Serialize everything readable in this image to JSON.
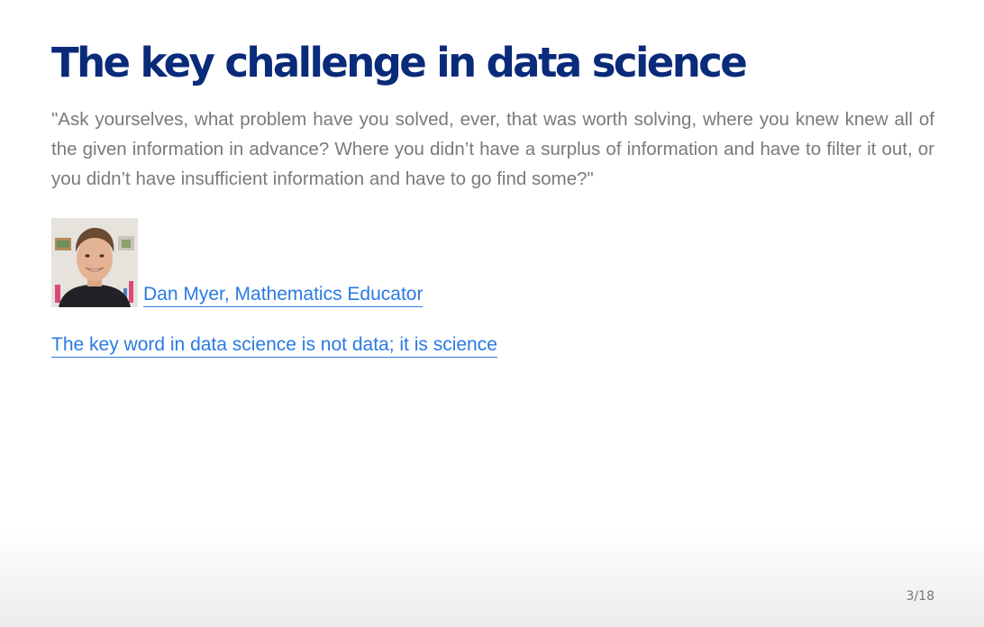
{
  "slide": {
    "title": "The key challenge in data science",
    "quote": "\"Ask yourselves, what problem have you solved, ever, that was worth solving, where you knew knew all of the given information in advance? Where you didn’t have a surplus of information and have to filter it out, or you didn’t have insufficient information and have to go find some?\"",
    "author": {
      "name": "Dan Myer, Mathematics Educator",
      "photo_icon": "person-photo-icon"
    },
    "key_link": "The key word in data science is not data; it is science",
    "page_number": "3/18"
  },
  "colors": {
    "title": "#0a2a7a",
    "quote": "#7a7a7a",
    "link": "#2a7ae2",
    "page_number": "#777777"
  }
}
